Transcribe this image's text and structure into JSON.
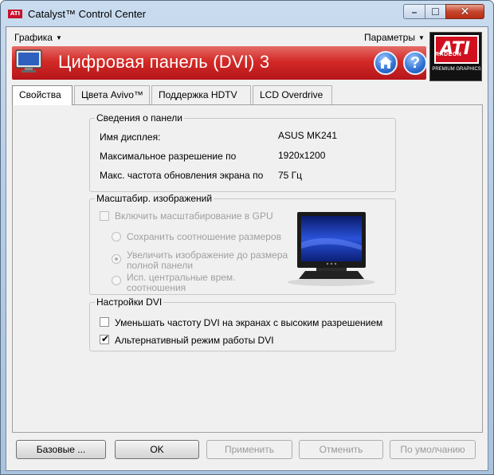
{
  "window": {
    "title": "Catalyst™ Control Center",
    "app_badge": "ATI"
  },
  "menu": {
    "graphics": "Графика",
    "options": "Параметры"
  },
  "banner": {
    "title": "Цифровая панель (DVI) 3",
    "help_glyph": "?"
  },
  "logo": {
    "brand": "ATI",
    "product": "RADEON",
    "tagline": "PREMIUM GRAPHICS"
  },
  "tabs": [
    {
      "label": "Свойства",
      "active": true
    },
    {
      "label": "Цвета Avivo™",
      "active": false
    },
    {
      "label": "Поддержка HDTV",
      "active": false
    },
    {
      "label": "LCD Overdrive",
      "active": false
    }
  ],
  "panel_info": {
    "title": "Сведения о панели",
    "rows": [
      {
        "label": "Имя дисплея:",
        "value": "ASUS MK241"
      },
      {
        "label": "Максимальное разрешение по",
        "value": "1920x1200"
      },
      {
        "label": "Макс. частота обновления экрана по",
        "value": "75 Гц"
      }
    ]
  },
  "scaling": {
    "title": "Масштабир. изображений",
    "enable_label": "Включить масштабирование в GPU",
    "opt1": "Сохранить соотношение размеров",
    "opt2_line1": "Увеличить изображение до размера",
    "opt2_line2": "полной панели",
    "opt3_line1": "Исп. центральные врем.",
    "opt3_line2": "соотношения"
  },
  "dvi": {
    "title": "Настройки DVI",
    "reduce_label": "Уменьшать частоту DVI на экранах с высоким разрешением",
    "alt_mode_label": "Альтернативный режим работы DVI"
  },
  "buttons": {
    "basic": "Базовые ...",
    "ok": "OK",
    "apply": "Применить",
    "cancel": "Отменить",
    "defaults": "По умолчанию"
  },
  "colors": {
    "banner_red": "#d32a26",
    "link_blue": "#2f6fd0"
  }
}
